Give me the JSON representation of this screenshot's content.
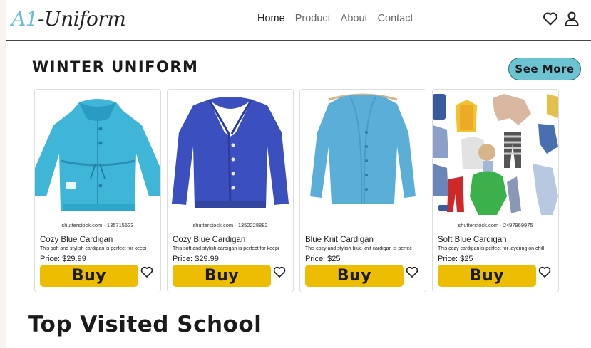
{
  "navbar": {
    "logo_prefix": "A1",
    "logo_suffix": "-Uniform",
    "links": [
      "Home",
      "Product",
      "About",
      "Contact"
    ]
  },
  "section": {
    "title": "WINTER UNIFORM",
    "see_more": "See More"
  },
  "products": [
    {
      "name": "Cozy Blue Cardigan",
      "description": "This soft and stylish cardigan is perfect for keepi",
      "price": "Price: $29.99",
      "credit": "shutterstock.com · 135715523",
      "buy": "Buy"
    },
    {
      "name": "Cozy Blue Cardigan",
      "description": "This soft and stylish cardigan is perfect for keepi",
      "price": "Price: $29.99",
      "credit": "shutterstock.com · 1352228882",
      "buy": "Buy"
    },
    {
      "name": "Blue Knit Cardigan",
      "description": "This cozy and stylish blue knit cardigan is perfec",
      "price": "Price: $25",
      "credit": "",
      "buy": "Buy"
    },
    {
      "name": "Soft Blue Cardigan",
      "description": "This cozy cardigan is perfect for layering on chill",
      "price": "Price: $25",
      "credit": "shutterstock.com · 2497969975",
      "buy": "Buy"
    }
  ],
  "bottom_title": "Top Visited School",
  "colors": {
    "accent": "#6cc3d1",
    "buy": "#ecbd00",
    "logo": "#6bbfcf"
  }
}
